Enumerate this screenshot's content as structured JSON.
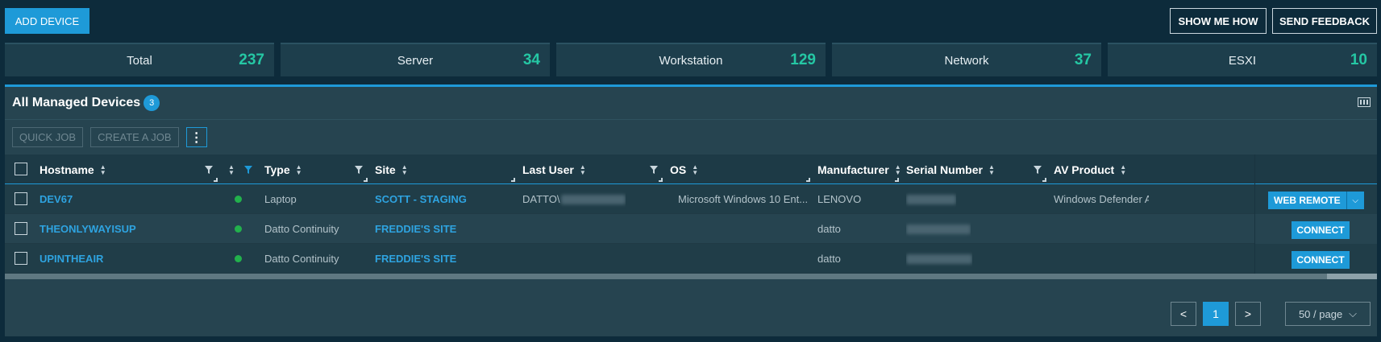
{
  "toolbar": {
    "add_device_label": "ADD DEVICE",
    "show_me_how_label": "SHOW ME HOW",
    "send_feedback_label": "SEND FEEDBACK"
  },
  "stats": [
    {
      "label": "Total",
      "value": "237"
    },
    {
      "label": "Server",
      "value": "34"
    },
    {
      "label": "Workstation",
      "value": "129"
    },
    {
      "label": "Network",
      "value": "37"
    },
    {
      "label": "ESXI",
      "value": "10"
    }
  ],
  "panel": {
    "title": "All Managed Devices",
    "count": "3",
    "quick_job_label": "QUICK JOB",
    "create_job_label": "CREATE A JOB",
    "more_label": "⋮"
  },
  "columns": {
    "hostname": "Hostname",
    "type": "Type",
    "site": "Site",
    "last_user": "Last User",
    "os": "OS",
    "manufacturer": "Manufacturer",
    "serial_number": "Serial Number",
    "av_product": "AV Product"
  },
  "rows": [
    {
      "hostname": "DEV67",
      "status": "online",
      "type": "Laptop",
      "site": "SCOTT - STAGING",
      "last_user": "DATTO\\",
      "os": "Microsoft Windows 10 Ent...",
      "manufacturer": "LENOVO",
      "av_product": "Windows Defender An",
      "action": "WEB REMOTE"
    },
    {
      "hostname": "THEONLYWAYISUP",
      "status": "online",
      "type": "Datto Continuity",
      "site": "FREDDIE'S SITE",
      "last_user": "",
      "os": "",
      "manufacturer": "datto",
      "av_product": "",
      "action": "CONNECT"
    },
    {
      "hostname": "UPINTHEAIR",
      "status": "online",
      "type": "Datto Continuity",
      "site": "FREDDIE'S SITE",
      "last_user": "",
      "os": "",
      "manufacturer": "datto",
      "av_product": "",
      "action": "CONNECT"
    }
  ],
  "pagination": {
    "prev": "<",
    "current_page": "1",
    "next": ">",
    "page_size": "50 / page"
  },
  "colors": {
    "accent": "#1e9ad8",
    "stat_value": "#25c7a4",
    "online": "#22b14c",
    "background": "#0d2b3b"
  }
}
